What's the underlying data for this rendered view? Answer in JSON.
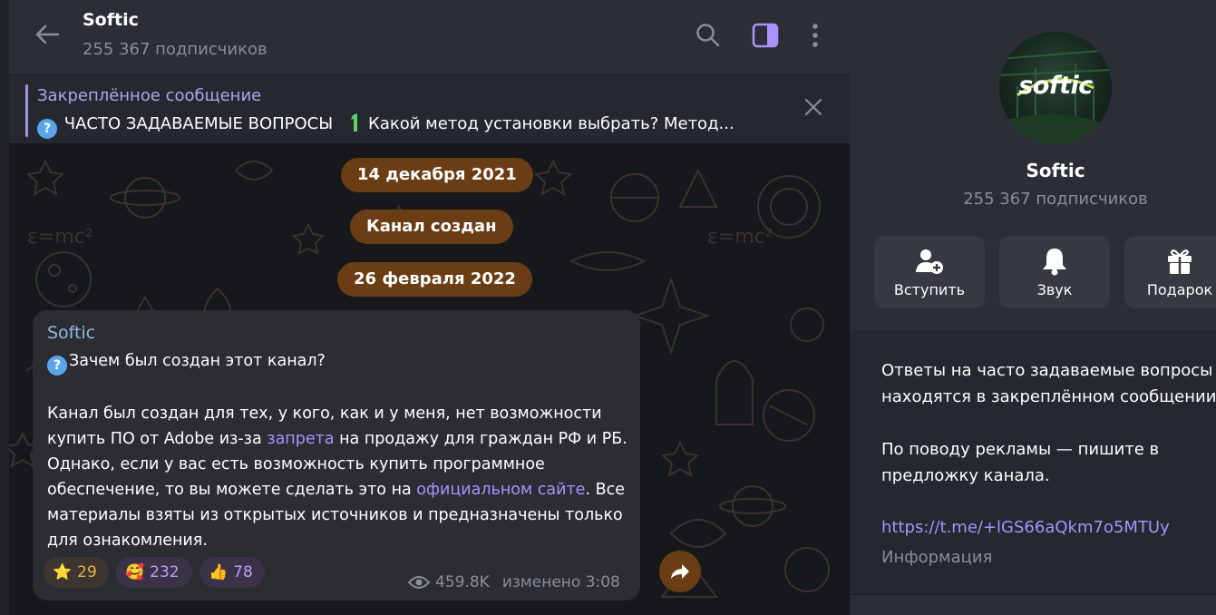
{
  "header": {
    "title": "Softic",
    "subscribers": "255 367 подписчиков",
    "icons": [
      "back-arrow-icon",
      "search-icon",
      "side-panel-icon",
      "more-vertical-icon"
    ]
  },
  "pinned": {
    "title": "Закреплённое сообщение",
    "text": "ЧАСТО ЗАДАВАЕМЫЕ ВОПРОСЫ",
    "number_emoji": "1",
    "text_rest": "Какой метод установки выбрать?  Метод..."
  },
  "dates": {
    "first": "14 декабря 2021",
    "service": "Канал создан",
    "second": "26 февраля 2022"
  },
  "message": {
    "author": "Softic",
    "question": "Зачем был создан этот канал?",
    "p1_a": "Канал был создан для тех, у кого, как и у меня, нет возможности купить ПО от Adobe из-за ",
    "p1_link": "запрета",
    "p1_b": " на продажу для граждан РФ и РБ. Однако, если у вас есть возможность купить программное обеспечение, то вы можете сделать это на ",
    "p1_link2": "официальном сайте",
    "p1_c": ". Все материалы взяты из открытых источников и предназначены только для ознакомления.",
    "reactions": [
      {
        "emoji": "⭐",
        "count": "29"
      },
      {
        "emoji": "🥰",
        "count": "232"
      },
      {
        "emoji": "👍",
        "count": "78"
      }
    ],
    "views": "459.8K",
    "edited": "изменено 3:08"
  },
  "panel": {
    "avatar_text": "softic",
    "name": "Softic",
    "subscribers": "255 367 подписчиков",
    "actions": [
      {
        "label": "Вступить",
        "icon": "add-user-icon"
      },
      {
        "label": "Звук",
        "icon": "bell-icon"
      },
      {
        "label": "Подарок",
        "icon": "gift-icon"
      }
    ],
    "desc_line1": "Ответы на часто задаваемые вопросы",
    "desc_line2": "находятся в закреплённом сообщении",
    "desc_line3": "По поводу рекламы — пишите в",
    "desc_line4": "предложку канала.",
    "link": "https://t.me/+lGS66aQkm7o5MTUy",
    "info_label": "Информация"
  },
  "colors": {
    "accent": "#a992ff",
    "author": "#8fb8e3",
    "pill": "#6a3d14",
    "bubble": "#2b2d33"
  }
}
